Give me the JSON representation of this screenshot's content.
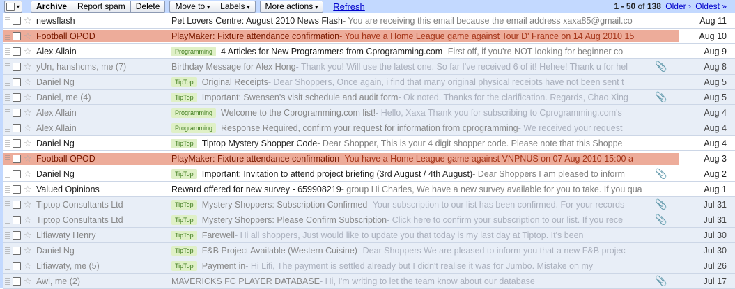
{
  "toolbar": {
    "archive": "Archive",
    "report_spam": "Report spam",
    "delete": "Delete",
    "move_to": "Move to",
    "labels": "Labels",
    "more_actions": "More actions",
    "refresh": "Refresh",
    "dropdown_glyph": "▾"
  },
  "pager": {
    "range": "1 - 50",
    "of_text": "of",
    "total": "138",
    "older": "Older ›",
    "oldest": "Oldest »"
  },
  "emails": [
    {
      "sender": "newsflash",
      "label": "",
      "subject": "Pet Lovers Centre: August 2010 News Flash",
      "snippet": " - You are receiving this email because the email address xaxa85@gmail.co",
      "attach": false,
      "date": "Aug 11",
      "unread": true,
      "highlight": false
    },
    {
      "sender": "Football OPOD",
      "label": "",
      "subject": "PlayMaker: Fixture attendance confirmation",
      "snippet": " - You have a Home League game against Tour D' France on 14 Aug 2010 15",
      "attach": false,
      "date": "Aug 10",
      "unread": true,
      "highlight": true
    },
    {
      "sender": "Alex Allain",
      "label": "Programming",
      "subject": "4 Articles for New Programmers from Cprogramming.com",
      "snippet": " - First off, if you're NOT looking for beginner co",
      "attach": false,
      "date": "Aug 9",
      "unread": true,
      "highlight": false
    },
    {
      "sender": "yUn, hanshcms, me (7)",
      "label": "",
      "subject": "Birthday Message for Alex Hong",
      "snippet": " - Thank you! Will use the latest one. So far I've received 6 of it! Hehee! Thank u for hel",
      "attach": true,
      "date": "Aug 8",
      "unread": false,
      "highlight": false
    },
    {
      "sender": "Daniel Ng",
      "label": "TipTop",
      "subject": "Original Receipts",
      "snippet": " - Dear Shoppers, Once again, i find that many original physical receipts have not been sent t",
      "attach": false,
      "date": "Aug 5",
      "unread": false,
      "highlight": false
    },
    {
      "sender": "Daniel, me (4)",
      "label": "TipTop",
      "subject": "Important: Swensen's visit schedule and audit form",
      "snippet": " - Ok noted. Thanks for the clarification. Regards, Chao Xing",
      "attach": true,
      "date": "Aug 5",
      "unread": false,
      "highlight": false
    },
    {
      "sender": "Alex Allain",
      "label": "Programming",
      "subject": "Welcome to the Cprogramming.com list!",
      "snippet": " - Hello, Xaxa Thank you for subscribing to Cprogramming.com's",
      "attach": false,
      "date": "Aug 4",
      "unread": false,
      "highlight": false
    },
    {
      "sender": "Alex Allain",
      "label": "Programming",
      "subject": "Response Required, confirm your request for information from cprogramming",
      "snippet": " - We received your request",
      "attach": false,
      "date": "Aug 4",
      "unread": false,
      "highlight": false
    },
    {
      "sender": "Daniel Ng",
      "label": "TipTop",
      "subject": "Tiptop Mystery Shopper Code",
      "snippet": " - Dear Shopper, This is your 4 digit shopper code. Please note that this Shoppe",
      "attach": false,
      "date": "Aug 4",
      "unread": true,
      "highlight": false
    },
    {
      "sender": "Football OPOD",
      "label": "",
      "subject": "PlayMaker: Fixture attendance confirmation",
      "snippet": " - You have a Home League game against VNPNUS on 07 Aug 2010 15:00 a",
      "attach": false,
      "date": "Aug 3",
      "unread": true,
      "highlight": true
    },
    {
      "sender": "Daniel Ng",
      "label": "TipTop",
      "subject": "Important: Invitation to attend project briefing (3rd August / 4th August)",
      "snippet": " - Dear Shoppers I am pleased to inform",
      "attach": true,
      "date": "Aug 2",
      "unread": true,
      "highlight": false
    },
    {
      "sender": "Valued Opinions",
      "label": "",
      "subject": "Reward offered for new survey - 659908219",
      "snippet": " - group Hi Charles, We have a new survey available for you to take. If you qua",
      "attach": false,
      "date": "Aug 1",
      "unread": true,
      "highlight": false
    },
    {
      "sender": "Tiptop Consultants Ltd",
      "label": "TipTop",
      "subject": "Mystery Shoppers: Subscription Confirmed",
      "snippet": " - Your subscription to our list has been confirmed. For your records",
      "attach": true,
      "date": "Jul 31",
      "unread": false,
      "highlight": false
    },
    {
      "sender": "Tiptop Consultants Ltd",
      "label": "TipTop",
      "subject": "Mystery Shoppers: Please Confirm Subscription",
      "snippet": " - Click here to confirm your subscription to our list. If you rece",
      "attach": true,
      "date": "Jul 31",
      "unread": false,
      "highlight": false
    },
    {
      "sender": "Lifiawaty Henry",
      "label": "TipTop",
      "subject": "Farewell",
      "snippet": " - Hi all shoppers, Just would like to update you that today is my last day at Tiptop. It's been",
      "attach": false,
      "date": "Jul 30",
      "unread": false,
      "highlight": false
    },
    {
      "sender": "Daniel Ng",
      "label": "TipTop",
      "subject": "F&B Project Available (Western Cuisine)",
      "snippet": " - Dear Shoppers We are pleased to inform you that a new F&B projec",
      "attach": false,
      "date": "Jul 30",
      "unread": false,
      "highlight": false
    },
    {
      "sender": "Lifiawaty, me (5)",
      "label": "TipTop",
      "subject": "Payment in",
      "snippet": " - Hi Lifi, The payment is settled already but I didn't realise it was for Jumbo. Mistake on my",
      "attach": false,
      "date": "Jul 26",
      "unread": false,
      "highlight": false
    },
    {
      "sender": "Awi, me (2)",
      "label": "",
      "subject": "MAVERICKS FC PLAYER DATABASE",
      "snippet": " - Hi, I'm writing to let the team know about our database",
      "attach": true,
      "date": "Jul 17",
      "unread": false,
      "highlight": false
    }
  ],
  "icons": {
    "star": "☆",
    "paperclip": "📎"
  }
}
